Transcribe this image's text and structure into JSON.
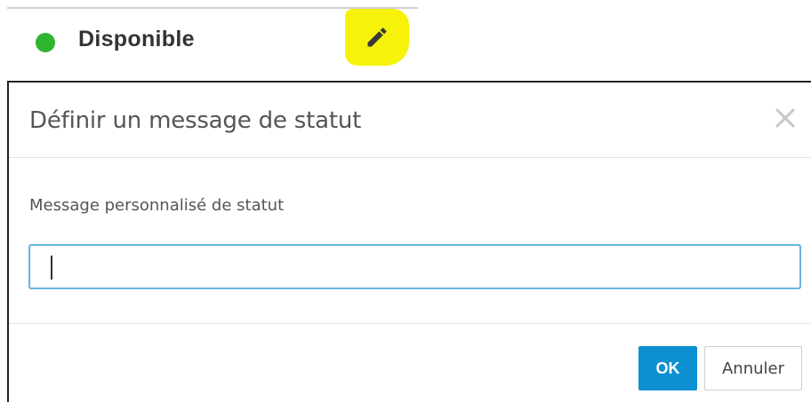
{
  "status": {
    "label": "Disponible",
    "dot_color": "#2fb52f",
    "icon": "status-dot-icon"
  },
  "edit": {
    "icon": "pencil-icon",
    "highlight_color": "#f6f20a"
  },
  "dialog": {
    "title": "Définir un message de statut",
    "close_icon": "close-icon",
    "field_label": "Message personnalisé de statut",
    "input_value": "",
    "input_placeholder": "",
    "ok_label": "OK",
    "cancel_label": "Annuler",
    "accent_color": "#0d8fd2",
    "focus_border_color": "#66b3e0"
  }
}
